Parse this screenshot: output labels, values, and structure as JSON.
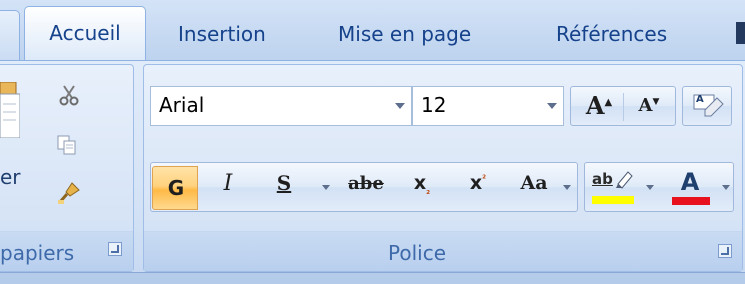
{
  "tabs": [
    "Accueil",
    "Insertion",
    "Mise en page",
    "Références"
  ],
  "clipboard": {
    "paste_partial": "er",
    "caption_partial": "papiers",
    "icons": [
      "paste-icon",
      "cut-icon",
      "copy-icon",
      "format-painter-icon"
    ]
  },
  "font_group": {
    "font_name": "Arial",
    "font_size": "12",
    "caption": "Police",
    "grow_glyph": "A",
    "shrink_glyph": "A",
    "bold_glyph": "G",
    "italic_glyph": "I",
    "underline_glyph": "S",
    "strike_glyph": "abe",
    "subscript_glyph": "x",
    "superscript_glyph": "x",
    "change_case_glyph": "Aa",
    "highlight_glyph": "ab",
    "font_color_glyph": "A",
    "clear_format_glyph": "A"
  },
  "colors": {
    "highlight": "#ffff00",
    "font_color": "#e8121e",
    "bold_active": "#ffc35a"
  }
}
